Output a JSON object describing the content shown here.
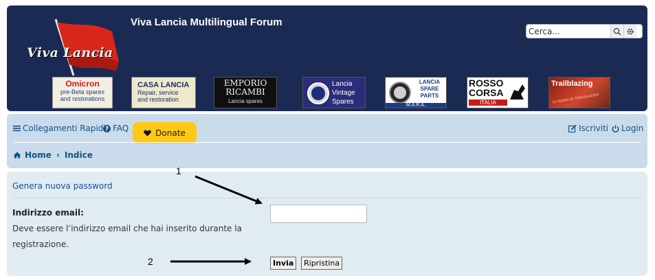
{
  "header": {
    "logo_text": "Viva Lancia",
    "site_title": "Viva Lancia Multilingual Forum",
    "search_placeholder": "Cerca..."
  },
  "banners": [
    {
      "name": "omicron",
      "lines": [
        "Omicron",
        "pre-Beta spares",
        "and restorations"
      ]
    },
    {
      "name": "casa-lancia",
      "lines": [
        "CASA LANCIA",
        "Repair, service",
        "and restoration"
      ]
    },
    {
      "name": "emporio-ricambi",
      "lines": [
        "EMPORIO",
        "RICAMBI",
        "Lancia spares"
      ]
    },
    {
      "name": "lancia-vintage-spares",
      "lines": [
        "Lancia",
        "Vintage",
        "Spares"
      ]
    },
    {
      "name": "lancia-spare-parts",
      "lines": [
        "LANCIA",
        "SPARE",
        "PARTS",
        "M.A.R.A."
      ]
    },
    {
      "name": "rosso-corsa",
      "lines": [
        "ROSSO",
        "CORSA",
        "ITALIA"
      ]
    },
    {
      "name": "trailblazing",
      "lines": [
        "Trailblazing",
        "70 YEARS OF TRAILBLAZING"
      ]
    }
  ],
  "nav": {
    "quick_links": "Collegamenti Rapidi",
    "faq": "FAQ",
    "donate": "Donate",
    "register": "Iscriviti",
    "login": "Login"
  },
  "breadcrumbs": {
    "home": "Home",
    "index": "Indice"
  },
  "form": {
    "title": "Genera nuova password",
    "email_label": "Indirizzo email:",
    "email_help": "Deve essere l’indirizzo email che hai inserito durante la registrazione.",
    "email_value": "",
    "submit": "Invia",
    "reset": "Ripristina"
  },
  "annotations": {
    "one": "1",
    "two": "2"
  },
  "colors": {
    "header_bg": "#1b2a52",
    "navbar_bg": "#cadceb",
    "panel_bg": "#e1ebf2",
    "link": "#105289",
    "donate_bg": "#ffc914"
  }
}
